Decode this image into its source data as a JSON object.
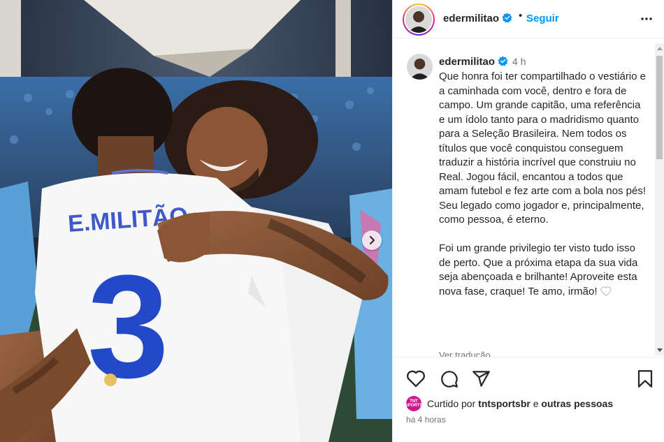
{
  "post": {
    "username": "edermilitao",
    "follow_label": "Seguir",
    "header_dot": "•",
    "time": "4 h",
    "caption_paragraphs": [
      "Que honra foi ter compartilhado o vestiário e a caminhada com você, dentro e fora de campo. Um grande capitão, uma referência e um ídolo tanto para o madridismo quanto para a Seleção Brasileira. Nem todos os títulos que você conquistou conseguem traduzir a história incrível que construiu no Real. Jogou fácil, encantou a todos que amam futebol e fez arte com a bola nos pés! Seu legado como jogador e, principalmente, como pessoa, é eterno.",
      "Foi um grande privilegio ter visto tudo isso de perto. Que a próxima etapa da sua vida seja abençoada e brilhante! Aproveite esta nova fase, craque! Te amo, irmão!"
    ],
    "see_translation": "Ver tradução",
    "liked": {
      "prefix": "Curtido por",
      "user": "tntsportsbr",
      "connector": "e",
      "others": "outras pessoas",
      "badge_text": "TNT SPORTS"
    },
    "posted_ago": "há 4 horas"
  },
  "photo": {
    "jersey_name": "E.MILITÃO",
    "jersey_number": "3"
  },
  "colors": {
    "follow_blue": "#0095f6",
    "verified_blue": "#0095f6",
    "badge_pink": "#d4148c"
  },
  "icons": [
    "verified-icon",
    "more-icon",
    "heart-icon",
    "comment-icon",
    "share-icon",
    "bookmark-icon",
    "chevron-right-icon"
  ]
}
